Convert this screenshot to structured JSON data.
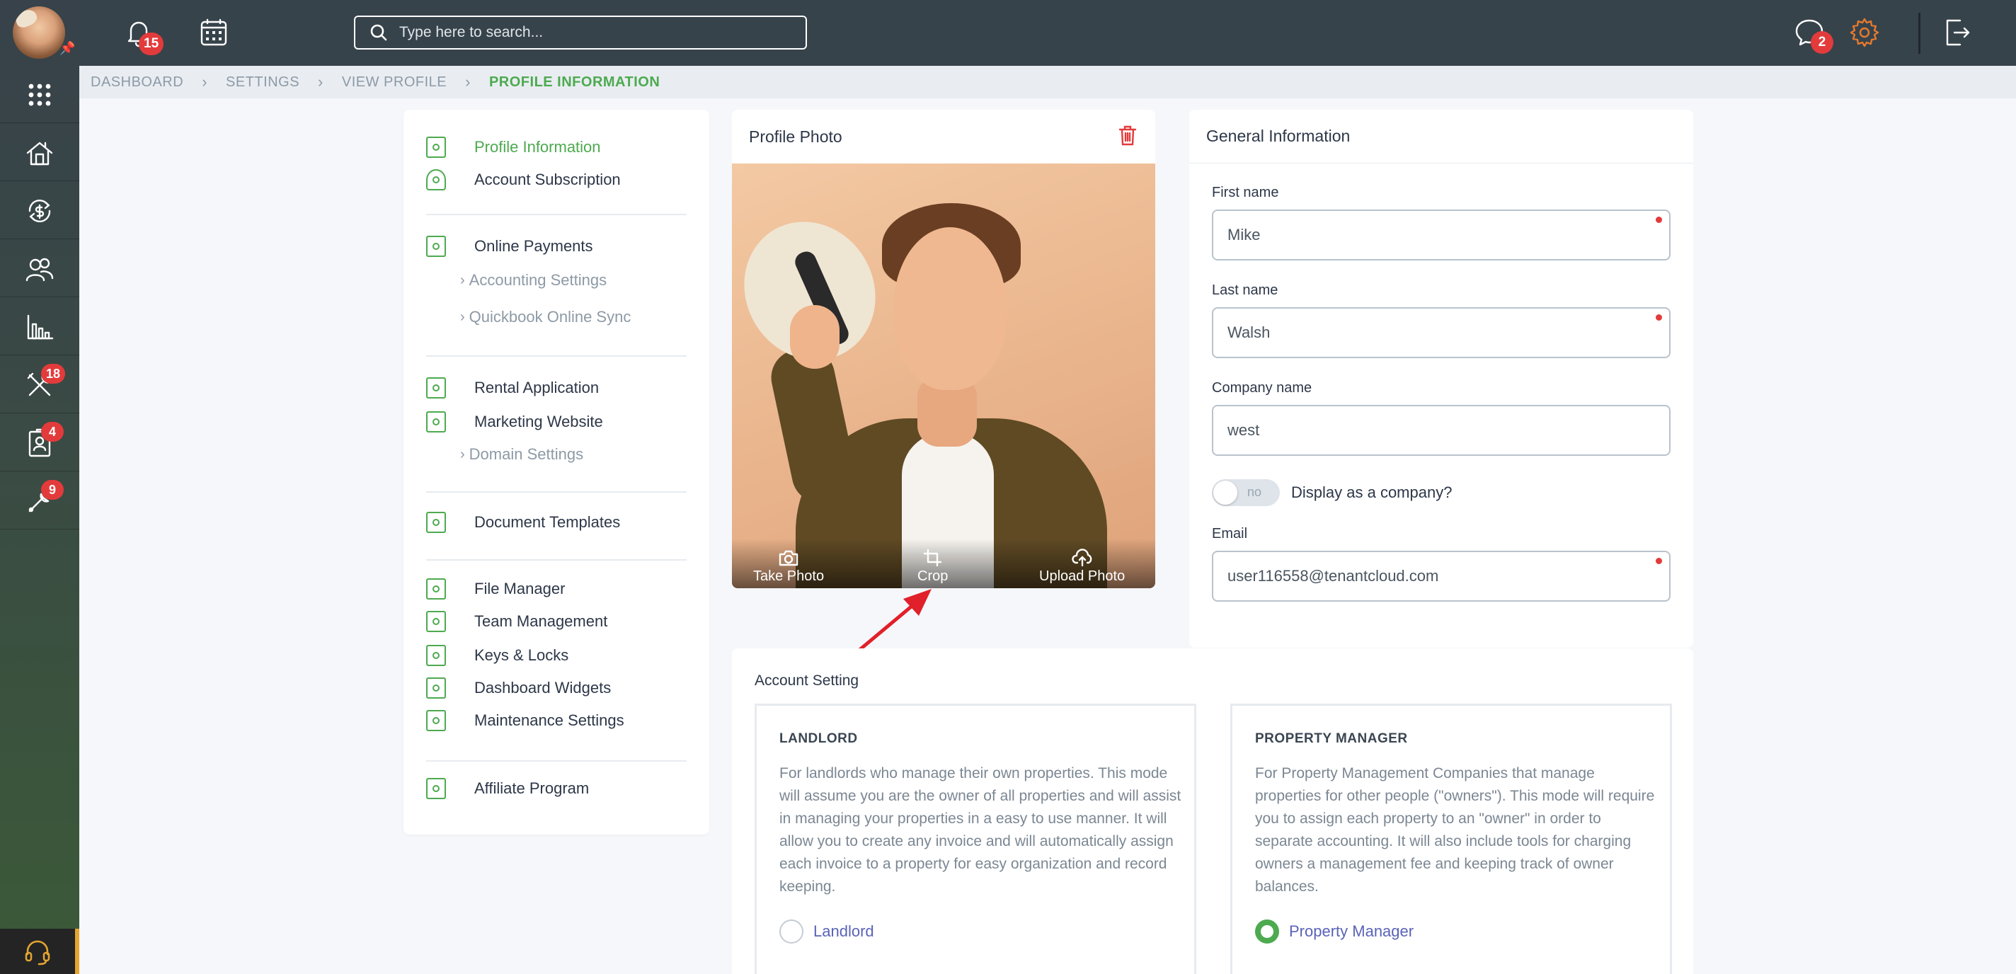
{
  "topbar": {
    "notifications_count": "15",
    "search_placeholder": "Type here to search...",
    "messages_count": "2"
  },
  "leftnav": {
    "badges": {
      "maintenance": "18",
      "tenants": "4",
      "tools": "9"
    }
  },
  "breadcrumb": [
    "DASHBOARD",
    "SETTINGS",
    "VIEW PROFILE",
    "PROFILE INFORMATION"
  ],
  "menu": {
    "profile_information": "Profile Information",
    "account_subscription": "Account Subscription",
    "online_payments": "Online Payments",
    "accounting_settings": "Accounting Settings",
    "quickbook_sync": "Quickbook Online Sync",
    "rental_application": "Rental Application",
    "marketing_website": "Marketing Website",
    "domain_settings": "Domain Settings",
    "document_templates": "Document Templates",
    "file_manager": "File Manager",
    "team_management": "Team Management",
    "keys_locks": "Keys & Locks",
    "dashboard_widgets": "Dashboard Widgets",
    "maintenance_settings": "Maintenance Settings",
    "affiliate_program": "Affiliate Program"
  },
  "photo": {
    "title": "Profile Photo",
    "take_photo": "Take Photo",
    "crop": "Crop",
    "upload_photo": "Upload Photo"
  },
  "general": {
    "title": "General Information",
    "first_name_label": "First name",
    "first_name_value": "Mike",
    "last_name_label": "Last name",
    "last_name_value": "Walsh",
    "company_label": "Company name",
    "company_value": "west",
    "toggle_text": "no",
    "display_company_label": "Display as a company?",
    "email_label": "Email",
    "email_value": "user116558@tenantcloud.com"
  },
  "account": {
    "title": "Account Setting",
    "landlord": {
      "heading": "LANDLORD",
      "description": "For landlords who manage their own properties. This mode will assume you are the owner of all properties and will assist in managing your properties in a easy to use manner. It will allow you to create any invoice and will automatically assign each invoice to a property for easy organization and record keeping.",
      "radio_label": "Landlord"
    },
    "pm": {
      "heading": "PROPERTY MANAGER",
      "description": "For Property Management Companies that manage properties for other people (\"owners\"). This mode will require you to assign each property to an \"owner\" in order to separate accounting. It will also include tools for charging owners a management fee and keeping track of owner balances.",
      "radio_label": "Property Manager"
    },
    "selected": "Property Manager"
  },
  "colors": {
    "accent_green": "#4daa4f",
    "badge_red": "#e33b3b",
    "topbar": "#37434b",
    "link_purple": "#5a63b8"
  }
}
